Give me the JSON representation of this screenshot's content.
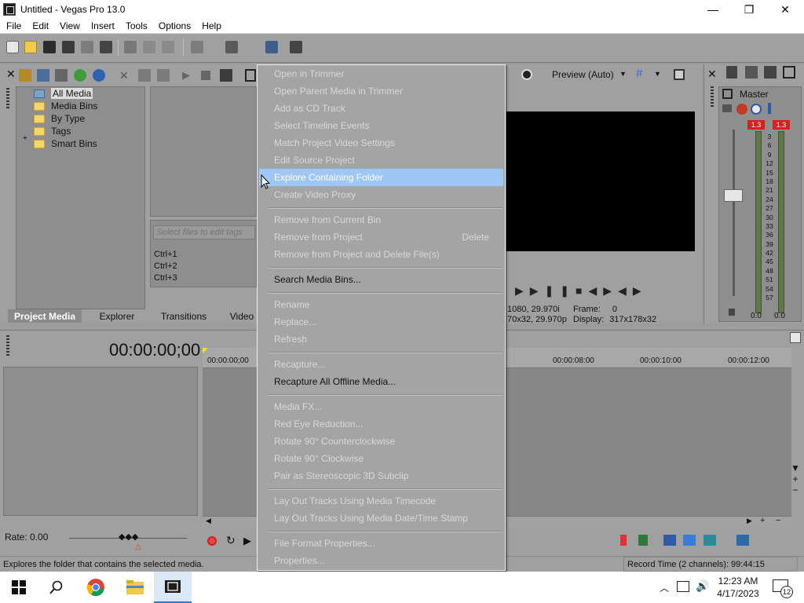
{
  "window": {
    "title": "Untitled - Vegas Pro 13.0",
    "minimize": "—",
    "maximize": "❐",
    "close": "✕"
  },
  "menubar": [
    "File",
    "Edit",
    "View",
    "Insert",
    "Tools",
    "Options",
    "Help"
  ],
  "media_tree": {
    "items": [
      "All Media",
      "Media Bins",
      "By Type",
      "Tags",
      "Smart Bins"
    ],
    "expander": "+"
  },
  "tags": {
    "placeholder": "Select files to edit tags",
    "shortcuts": [
      "Ctrl+1",
      "Ctrl+2",
      "Ctrl+3"
    ]
  },
  "tabs": [
    "Project Media",
    "Explorer",
    "Transitions",
    "Video"
  ],
  "preview": {
    "mode": "Preview (Auto)",
    "res_info": "1080, 29.970i",
    "res_info2": "70x32, 29.970p",
    "frame_label": "Frame:",
    "frame_value": "0",
    "display_label": "Display:",
    "display_value": "317x178x32"
  },
  "master": {
    "title": "Master",
    "peak_left": "1.3",
    "peak_right": "1.3",
    "scale": [
      "3",
      "6",
      "9",
      "12",
      "15",
      "18",
      "21",
      "24",
      "27",
      "30",
      "33",
      "36",
      "39",
      "42",
      "45",
      "48",
      "51",
      "54",
      "57"
    ],
    "bottom_left": "0.0",
    "bottom_right": "0.0"
  },
  "timeline": {
    "timecode": "00:00:00;00",
    "ruler": [
      "00:00:00;00",
      "00:00:08:00",
      "00:00:10:00",
      "00:00:12:00"
    ],
    "rate": "Rate: 0.00"
  },
  "status": {
    "left": "Explores the folder that contains the selected media.",
    "right": "Record Time (2 channels): 99:44:15"
  },
  "context_menu": {
    "items": [
      {
        "label": "Open in Trimmer",
        "enabled": false
      },
      {
        "label": "Open Parent Media in Trimmer",
        "enabled": false
      },
      {
        "label": "Add as CD Track",
        "enabled": false
      },
      {
        "label": "Select Timeline Events",
        "enabled": false
      },
      {
        "label": "Match Project Video Settings",
        "enabled": false
      },
      {
        "label": "Edit Source Project",
        "enabled": false
      },
      {
        "label": "Explore Containing Folder",
        "enabled": true,
        "highlighted": true
      },
      {
        "label": "Create Video Proxy",
        "enabled": false
      },
      {
        "label": "Remove from Current Bin",
        "enabled": false
      },
      {
        "label": "Remove from Project",
        "enabled": false,
        "shortcut": "Delete"
      },
      {
        "label": "Remove from Project and Delete File(s)",
        "enabled": false
      },
      {
        "label": "Search Media Bins...",
        "enabled": true
      },
      {
        "label": "Rename",
        "enabled": false
      },
      {
        "label": "Replace...",
        "enabled": false
      },
      {
        "label": "Refresh",
        "enabled": false
      },
      {
        "label": "Recapture...",
        "enabled": false
      },
      {
        "label": "Recapture All Offline Media...",
        "enabled": true
      },
      {
        "label": "Media FX...",
        "enabled": false
      },
      {
        "label": "Red Eye Reduction...",
        "enabled": false
      },
      {
        "label": "Rotate 90° Counterclockwise",
        "enabled": false
      },
      {
        "label": "Rotate 90° Clockwise",
        "enabled": false
      },
      {
        "label": "Pair as Stereoscopic 3D Subclip",
        "enabled": false
      },
      {
        "label": "Lay Out Tracks Using Media Timecode",
        "enabled": false
      },
      {
        "label": "Lay Out Tracks Using Media Date/Time Stamp",
        "enabled": false
      },
      {
        "label": "File Format Properties...",
        "enabled": false
      },
      {
        "label": "Properties...",
        "enabled": false
      }
    ]
  },
  "taskbar": {
    "time": "12:23 AM",
    "date": "4/17/2023",
    "notifications": "12"
  },
  "colors": {
    "highlight": "#9ec7f5",
    "panel": "#a0a0a0",
    "peak": "#e01d1d",
    "meter": "#5e7a44"
  }
}
